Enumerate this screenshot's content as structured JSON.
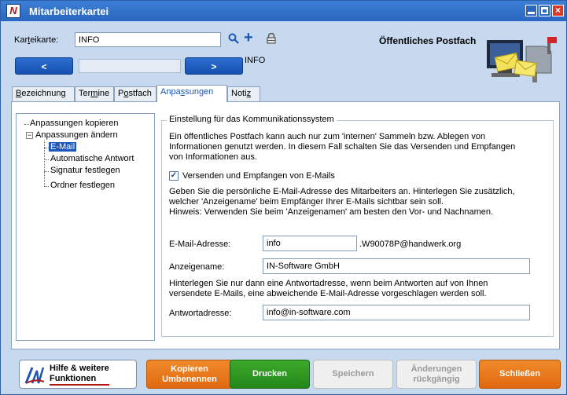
{
  "window": {
    "title": "Mitarbeiterkartei",
    "app_icon": "app-logo-icon"
  },
  "header": {
    "karteikarte_label_pre": "Kar",
    "karteikarte_label_u": "t",
    "karteikarte_label_post": "eikarte:",
    "karteikarte_value": "INFO",
    "prev_label": "<",
    "next_label": ">",
    "current_record": "INFO",
    "public_mailbox_label": "Öffentliches Postfach"
  },
  "tabs": [
    {
      "pre": "",
      "u": "B",
      "post": "ezeichnung"
    },
    {
      "pre": "Ter",
      "u": "m",
      "post": "ine"
    },
    {
      "pre": "P",
      "u": "o",
      "post": "stfach"
    },
    {
      "pre": "Anpa",
      "u": "s",
      "post": "sungen"
    },
    {
      "pre": "Noti",
      "u": "z",
      "post": ""
    }
  ],
  "tree": {
    "items": [
      "Anpassungen kopieren",
      "Anpassungen ändern",
      "E-Mail",
      "Automatische Antwort",
      "Signatur festlegen",
      "Ordner festlegen"
    ],
    "expander_symbol": "−"
  },
  "settings": {
    "group_title": "Einstellung für das Kommunikationssystem",
    "intro_line1": "Ein öffentliches Postfach kann auch nur zum 'internen' Sammeln bzw. Ablegen von",
    "intro_line2": "Informationen genutzt werden. In diesem Fall schalten Sie das Versenden und Empfangen",
    "intro_line3": "von Informationen aus.",
    "checkbox_label": "Versenden und Empfangen von E-Mails",
    "checkbox_mark": "✓",
    "hint_line1": "Geben Sie die persönliche E-Mail-Adresse des Mitarbeiters an. Hinterlegen Sie zusätzlich,",
    "hint_line2": "welcher 'Anzeigename' beim Empfänger Ihrer E-Mails sichtbar sein soll.",
    "hint_line3": "Hinweis: Verwenden Sie beim 'Anzeigenamen' am besten den Vor- und Nachnamen.",
    "email_label": "E-Mail-Adresse:",
    "email_value": "info",
    "email_domain": ".W90078P@handwerk.org",
    "display_name_label": "Anzeigename:",
    "display_name_value": "IN-Software GmbH",
    "reply_hint_line1": "Hinterlegen Sie nur dann eine Antwortadresse, wenn beim Antworten auf von Ihnen",
    "reply_hint_line2": "versendete E-Mails, eine abweichende E-Mail-Adresse vorgeschlagen werden soll.",
    "reply_label": "Antwortadresse:",
    "reply_value": "info@in-software.com"
  },
  "footer": {
    "help_line1": "Hilfe & weitere",
    "help_line2": "Funktionen",
    "help_logo_text": "iN",
    "copy_line1": "Kopieren",
    "copy_line2": "Umbenennen",
    "print_label": "Drucken",
    "save_label": "Speichern",
    "undo_line1": "Änderungen",
    "undo_line2": "rückgängig",
    "close_label": "Schließen"
  },
  "colors": {
    "titlebar": "#2a66bf",
    "accent_blue": "#1d55b8",
    "orange": "#e06910",
    "green": "#24861a"
  }
}
